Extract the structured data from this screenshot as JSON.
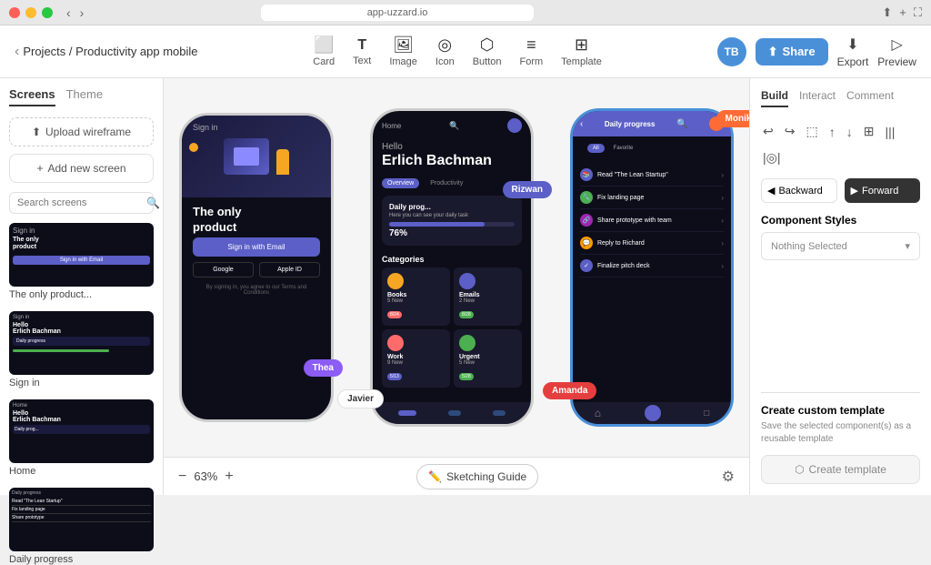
{
  "titlebar": {
    "address": "app-uzzard.io"
  },
  "header": {
    "back_label": "‹",
    "breadcrumb": "Projects / Productivity app mobile",
    "toolbar": [
      {
        "label": "Card",
        "icon": "⬜"
      },
      {
        "label": "Text",
        "icon": "T"
      },
      {
        "label": "Image",
        "icon": "🖼"
      },
      {
        "label": "Icon",
        "icon": "◎"
      },
      {
        "label": "Button",
        "icon": "⬡"
      },
      {
        "label": "Form",
        "icon": "≡"
      },
      {
        "label": "Template",
        "icon": "⊞"
      }
    ],
    "avatar": "TB",
    "share_label": "Share",
    "export_label": "Export",
    "preview_label": "Preview"
  },
  "sidebar": {
    "tabs": [
      "Screens",
      "Theme"
    ],
    "active_tab": "Screens",
    "upload_btn": "Upload wireframe",
    "add_btn": "Add new screen",
    "search_placeholder": "Search screens",
    "screens": [
      {
        "label": "The only product...",
        "id": "screen-1"
      },
      {
        "label": "Sign in",
        "id": "screen-2"
      },
      {
        "label": "Home",
        "id": "screen-3"
      },
      {
        "label": "Daily progress",
        "id": "screen-4"
      }
    ]
  },
  "canvas": {
    "screens": [
      {
        "id": "signin",
        "label": "Sign in",
        "title": "The only product",
        "email_btn": "Sign in with Email",
        "google_btn": "Google",
        "apple_btn": "Apple ID",
        "terms": "By signing in, you agree to our Terms and Conditions"
      },
      {
        "id": "home",
        "label": "Home",
        "hello": "Hello",
        "name": "Hello\nErlich Bachman",
        "tab1": "Overview",
        "tab2": "Productivity",
        "progress_title": "Daily prog...",
        "progress_sub": "Here you can see your daily task",
        "progress_pct": "76%",
        "categories_title": "Categories",
        "categories": [
          {
            "name": "Books",
            "count": "5 New",
            "badge": "8/24"
          },
          {
            "name": "Emails",
            "count": "2 New",
            "badge": "8/28"
          },
          {
            "name": "Work",
            "count": "9 New",
            "badge": "5/13"
          },
          {
            "name": "Urgent",
            "count": "5 New",
            "badge": "5/28"
          }
        ]
      },
      {
        "id": "daily",
        "label": "Daily progress",
        "title": "Daily progress",
        "filters": [
          "All",
          "Favorite"
        ],
        "tasks": [
          {
            "name": "Read \"The Lean Startup\"",
            "color": "#5b5fc7"
          },
          {
            "name": "Fix landing page",
            "color": "#4caf50"
          },
          {
            "name": "Share prototype with team",
            "color": "#9c27b0"
          },
          {
            "name": "Reply to Richard",
            "color": "#ff9800"
          },
          {
            "name": "Finalize pitch deck",
            "color": "#5b5fc7"
          }
        ]
      }
    ],
    "collaborators": [
      {
        "name": "Thea",
        "color": "#8b5cf6"
      },
      {
        "name": "Javier",
        "color": "#ffffff"
      },
      {
        "name": "Rizwan",
        "color": "#5b5fc7"
      },
      {
        "name": "Monika",
        "color": "#ff6b35"
      },
      {
        "name": "Amanda",
        "color": "#e53e3e"
      }
    ],
    "zoom": "63%",
    "zoom_minus": "−",
    "zoom_plus": "+"
  },
  "right_panel": {
    "tabs": [
      "Build",
      "Interact",
      "Comment"
    ],
    "active_tab": "Build",
    "tools": [
      "↩",
      "↪",
      "⬚",
      "↑",
      "↓",
      "⊞",
      "|||",
      "|◎|"
    ],
    "backward_label": "Backward",
    "forward_label": "Forward",
    "component_styles_title": "Component Styles",
    "component_dropdown": "Nothing Selected",
    "create_template": {
      "title": "Create custom template",
      "desc": "Save the selected component(s) as a reusable template",
      "btn_label": "Create template"
    }
  },
  "footer": {
    "sketching_guide": "Sketching Guide"
  }
}
